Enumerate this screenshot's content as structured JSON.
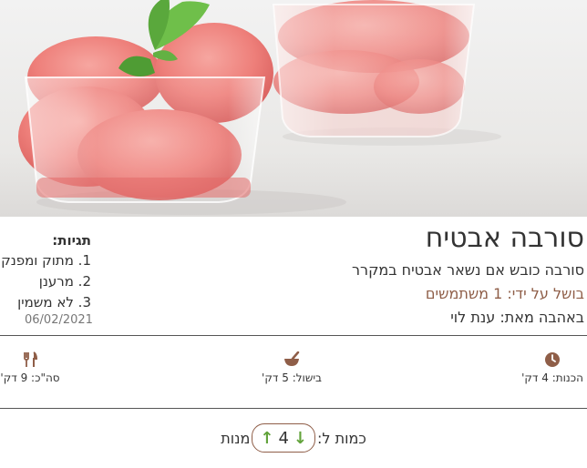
{
  "hero": {
    "image_name": "watermelon-sorbet-photo"
  },
  "recipe": {
    "title": "סורבה אבטיח",
    "subtitle": "סורבה כובש אם נשאר אבטיח במקרר",
    "cooked_by": "בושל על ידי: 1 משתמשים",
    "with_love_from": "באהבה מאת: ענת לוי",
    "date": "06/02/2021"
  },
  "tags": {
    "title": "תגיות:",
    "items": [
      "1. מתוק ומפנק",
      "2. מרענן",
      "3. לא משמין"
    ]
  },
  "times": {
    "prep": {
      "label": "הכנות: 4 דק'",
      "icon": "clock-icon"
    },
    "cook": {
      "label": "בישול: 5 דק'",
      "icon": "mortar-bowl-icon"
    },
    "total": {
      "label": "סה\"כ: 9 דק'",
      "icon": "fork-knife-icon"
    }
  },
  "quantity": {
    "label": "כמות ל:",
    "value": "4",
    "unit": "מנות"
  },
  "colors": {
    "accent": "#8f5e48",
    "arrow": "#62a33b"
  }
}
